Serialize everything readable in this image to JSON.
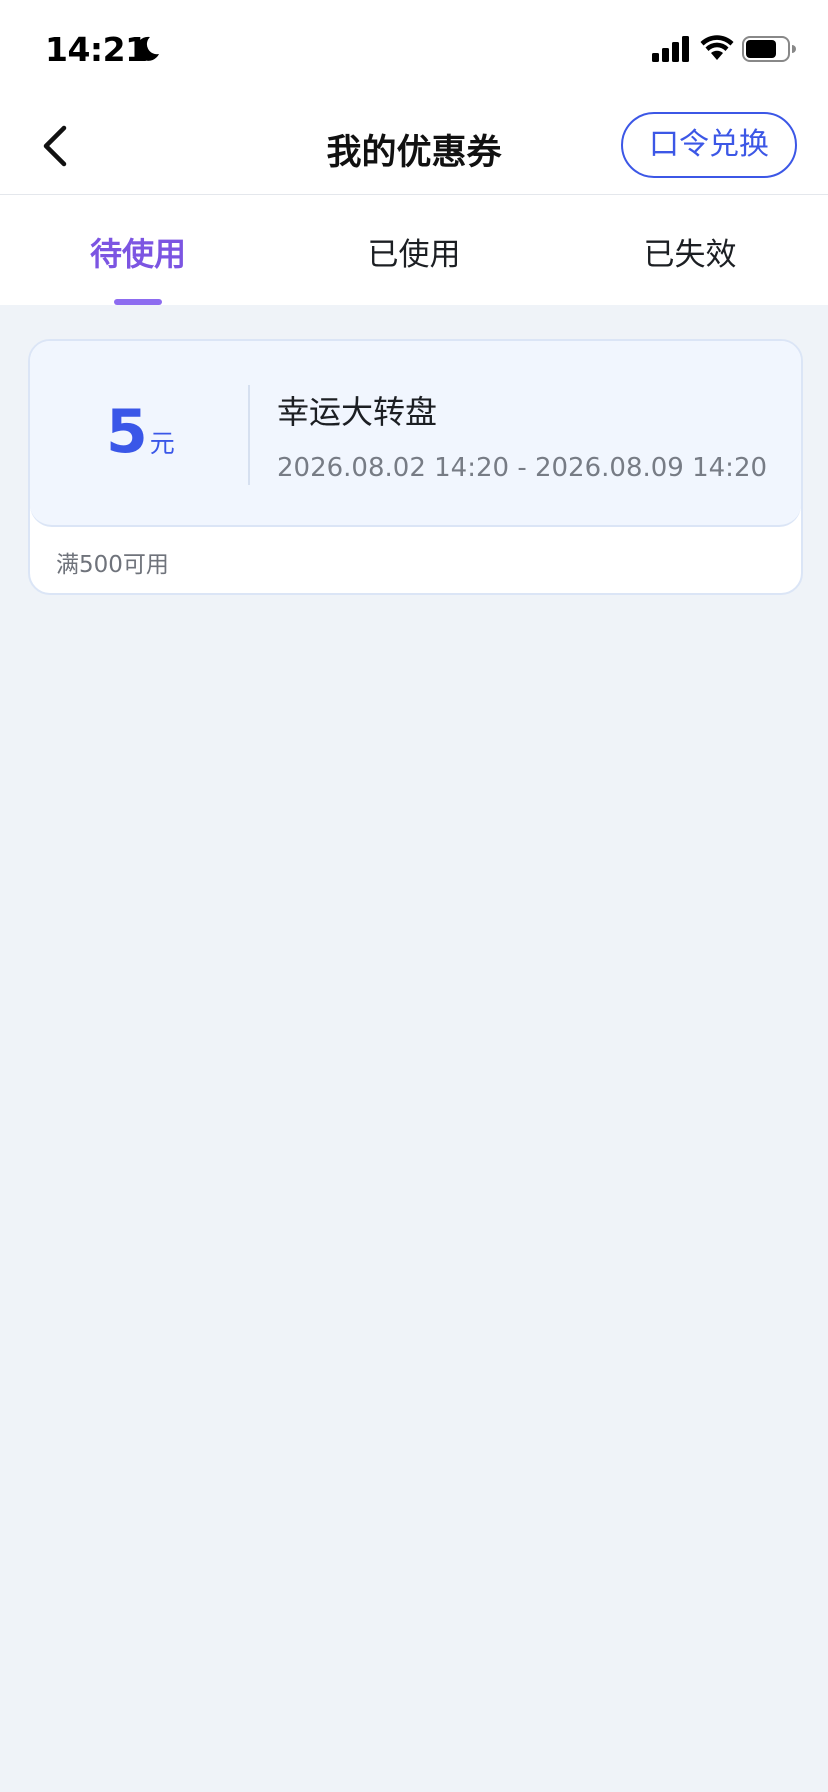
{
  "status_bar": {
    "time": "14:21"
  },
  "nav": {
    "title": "我的优惠券",
    "redeem_label": "口令兑换"
  },
  "tabs": [
    {
      "label": "待使用",
      "active": true
    },
    {
      "label": "已使用",
      "active": false
    },
    {
      "label": "已失效",
      "active": false
    }
  ],
  "coupons": [
    {
      "amount": "5",
      "unit": "元",
      "name": "幸运大转盘",
      "period": "2026.08.02 14:20 - 2026.08.09 14:20",
      "condition": "满500可用"
    }
  ],
  "colors": {
    "accent_blue": "#3a57e8",
    "tab_active_purple": "#7c55e2",
    "page_background": "#eff3f8"
  },
  "icons": {
    "back": "chevron-left-icon",
    "dnd": "moon-icon",
    "signal": "cellular-signal-icon",
    "wifi": "wifi-icon",
    "battery": "battery-icon"
  }
}
